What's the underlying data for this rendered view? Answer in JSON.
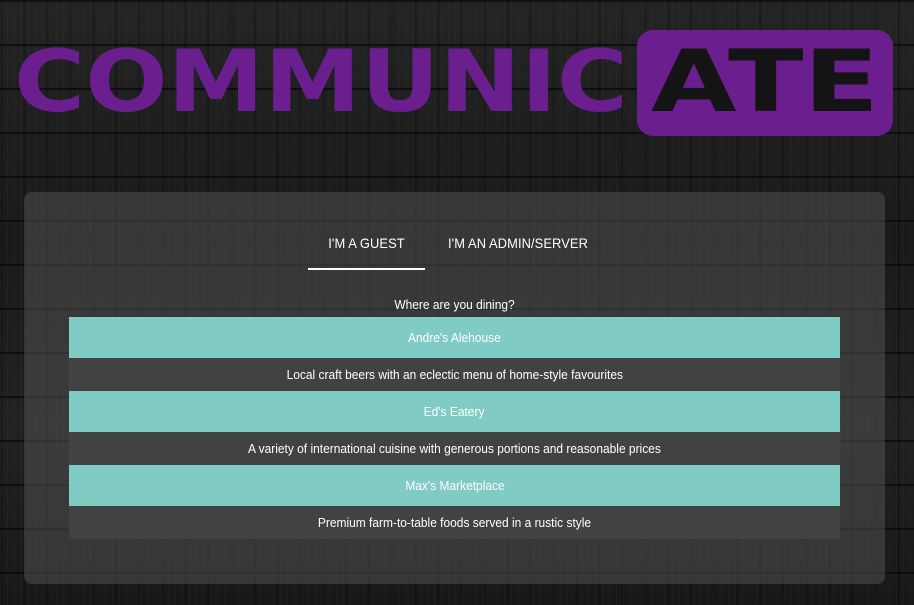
{
  "logo": {
    "text_plain": "COMMUNIC",
    "text_boxed": "ATE",
    "color": "#6b1f8f"
  },
  "tabs": [
    {
      "label": "I'M A GUEST",
      "active": true
    },
    {
      "label": "I'M AN ADMIN/SERVER",
      "active": false
    }
  ],
  "prompt": "Where are you dining?",
  "restaurants": [
    {
      "name": "Andre's Alehouse",
      "description": "Local craft beers with an eclectic menu of home-style favourites"
    },
    {
      "name": "Ed's Eatery",
      "description": "A variety of international cuisine with generous portions and reasonable prices"
    },
    {
      "name": "Max's Marketplace",
      "description": "Premium farm-to-table foods served in a rustic style"
    }
  ],
  "colors": {
    "accent_teal": "#80cbc4",
    "description_bg": "#424242",
    "logo_purple": "#6b1f8f"
  }
}
